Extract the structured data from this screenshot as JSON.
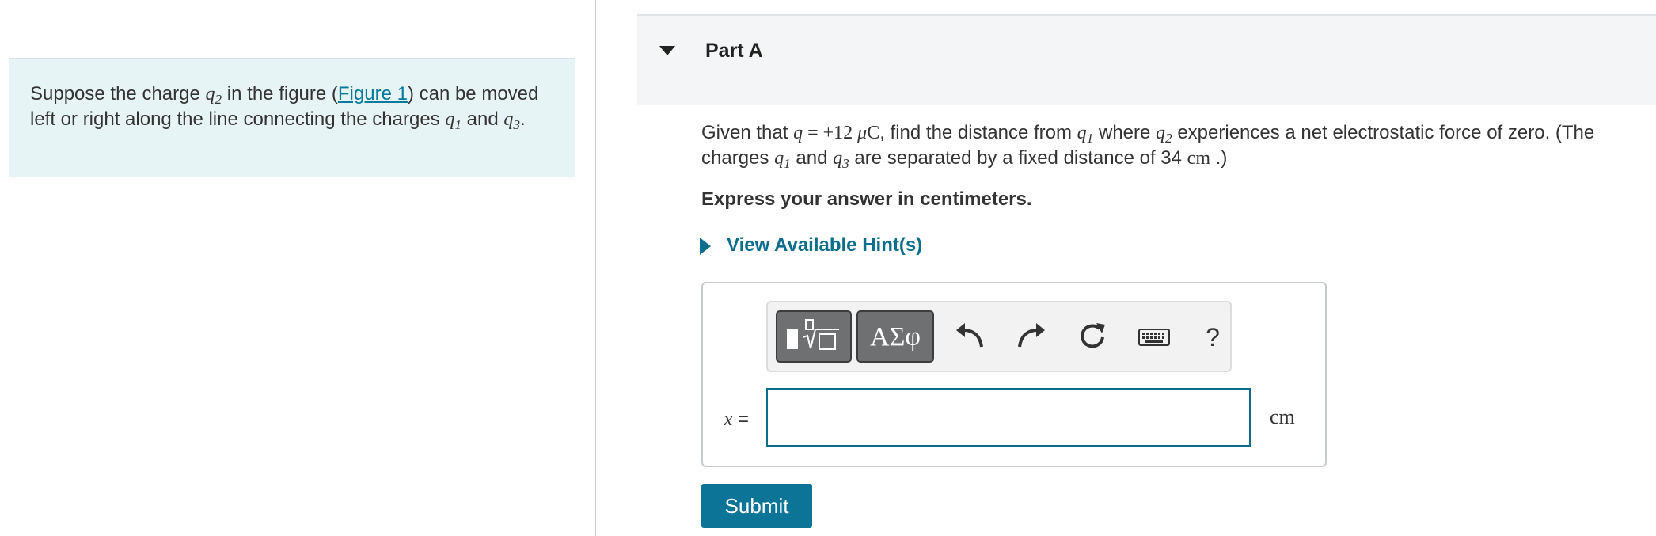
{
  "intro": {
    "prefix": "Suppose the charge ",
    "q2_base": "q",
    "q2_sub": "2",
    "in_the_figure": " in the figure (",
    "figure_link": "Figure 1",
    "rest_a": ") can be moved left or right along the line connecting the charges ",
    "q1_base": "q",
    "q1_sub": "1",
    "and": " and ",
    "q3_base": "q",
    "q3_sub": "3",
    "period": "."
  },
  "part": {
    "title": "Part A"
  },
  "question": {
    "given_that": "Given that ",
    "q_var": "q",
    "equals": " = +12 ",
    "mu": "μ",
    "coulomb": "C",
    "find_text": ", find the distance from ",
    "q1_base": "q",
    "q1_sub": "1",
    "where": " where ",
    "q2_base": "q",
    "q2_sub": "2",
    "experiences": " experiences a net electrostatic force of zero. (The charges ",
    "q1b_base": "q",
    "q1b_sub": "1",
    "and": " and ",
    "q3_base": "q",
    "q3_sub": "3",
    "separated": " are separated by a fixed distance of 34 ",
    "unit": "cm",
    "close": " .)"
  },
  "instruction": "Express your answer in centimeters.",
  "hint": {
    "label": "View Available Hint(s)"
  },
  "answer": {
    "variable": "x",
    "equals": " =",
    "value": "",
    "unit": "cm",
    "symbols_label": "ΑΣφ",
    "help_label": "?"
  },
  "submit_label": "Submit",
  "colors": {
    "accent": "#0b6e8c",
    "intro_bg": "#e7f4f5",
    "toolbar_button": "#6f7072",
    "submit_bg": "#0b7497"
  },
  "icons": [
    "templates-icon",
    "undo-icon",
    "redo-icon",
    "reset-icon",
    "keyboard-icon",
    "caret-down-icon",
    "caret-right-icon"
  ]
}
